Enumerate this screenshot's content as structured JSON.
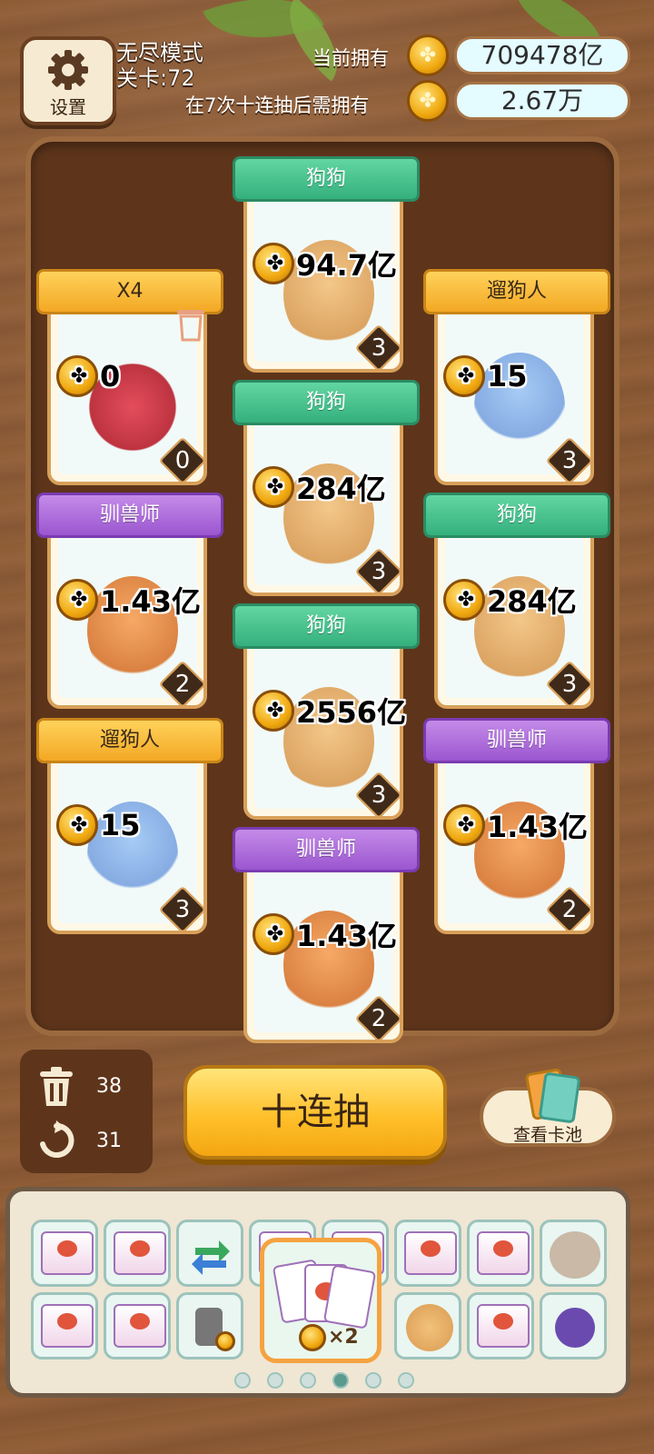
{
  "header": {
    "settings_label": "设置",
    "mode": "无尽模式",
    "level": "关卡:72",
    "owned_label": "当前拥有",
    "owned_value": "709478亿",
    "need_label": "在7次十连抽后需拥有",
    "need_value": "2.67万"
  },
  "cards": [
    {
      "title": "狗狗",
      "value": "94.7亿",
      "level": "3",
      "ribbon": "green",
      "art": "dog"
    },
    {
      "title": "X4",
      "value": "0",
      "level": "0",
      "ribbon": "gold",
      "art": "x4"
    },
    {
      "title": "遛狗人",
      "value": "15",
      "level": "3",
      "ribbon": "gold",
      "art": "girl"
    },
    {
      "title": "狗狗",
      "value": "284亿",
      "level": "3",
      "ribbon": "green",
      "art": "dog"
    },
    {
      "title": "驯兽师",
      "value": "1.43亿",
      "level": "2",
      "ribbon": "purple",
      "art": "tiger"
    },
    {
      "title": "狗狗",
      "value": "284亿",
      "level": "3",
      "ribbon": "green",
      "art": "dog"
    },
    {
      "title": "狗狗",
      "value": "2556亿",
      "level": "3",
      "ribbon": "green",
      "art": "dog"
    },
    {
      "title": "遛狗人",
      "value": "15",
      "level": "3",
      "ribbon": "gold",
      "art": "girl"
    },
    {
      "title": "驯兽师",
      "value": "1.43亿",
      "level": "2",
      "ribbon": "purple",
      "art": "tiger"
    },
    {
      "title": "驯兽师",
      "value": "1.43亿",
      "level": "2",
      "ribbon": "purple",
      "art": "tiger"
    }
  ],
  "controls": {
    "trash_count": "38",
    "refresh_count": "31",
    "draw_label": "十连抽",
    "pool_label": "查看卡池"
  },
  "inventory": {
    "selected_badge": "×2",
    "page_count": 6,
    "active_page": 3
  },
  "colors": {
    "ribbon_green": "#34b07c",
    "ribbon_gold": "#f3a824",
    "ribbon_purple": "#9b56d0",
    "draw_button": "#ffc02b",
    "value_pill": "#e4fbff"
  }
}
